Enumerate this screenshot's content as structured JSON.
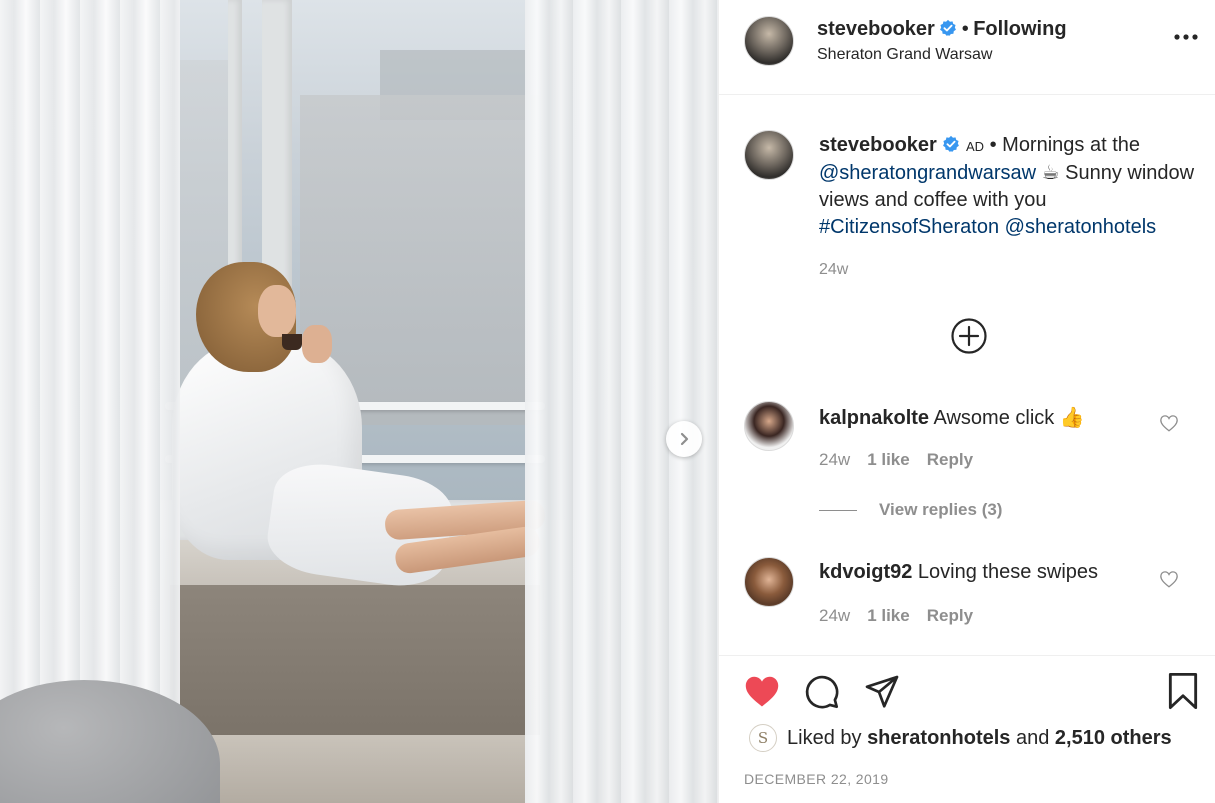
{
  "post": {
    "username": "stevebooker",
    "separator": "•",
    "follow_status": "Following",
    "location": "Sheraton Grand Warsaw"
  },
  "caption": {
    "username": "stevebooker",
    "ad_label": "AD",
    "intro": "• Mornings at the",
    "mention_hotel": "@sheratongrandwarsaw",
    "emoji": "☕",
    "body": "Sunny window views and coffee with you",
    "hashtag": "#CitizensofSheraton",
    "mention_brand": "@sheratonhotels",
    "age": "24w"
  },
  "comments": [
    {
      "username": "kalpnakolte",
      "text": "Awsome click",
      "emoji": "👍",
      "age": "24w",
      "likes": "1 like",
      "reply": "Reply"
    },
    {
      "username": "kdvoigt92",
      "text": "Loving these swipes",
      "age": "24w",
      "likes": "1 like",
      "reply": "Reply"
    }
  ],
  "view_replies": "View replies (3)",
  "likes": {
    "prefix": "Liked by",
    "user": "sheratonhotels",
    "middle": "and",
    "others": "2,510 others",
    "avatar_letter": "S"
  },
  "date": "DECEMBER 22, 2019",
  "colors": {
    "like_red": "#ed4956",
    "verified_blue": "#3897f0",
    "link_blue": "#00376b",
    "muted_gray": "#8e8e8e"
  },
  "icons": [
    "more-icon",
    "plus-icon",
    "heart-icon",
    "comment-icon",
    "share-icon",
    "bookmark-icon",
    "chevron-right-icon",
    "verified-badge-icon"
  ]
}
